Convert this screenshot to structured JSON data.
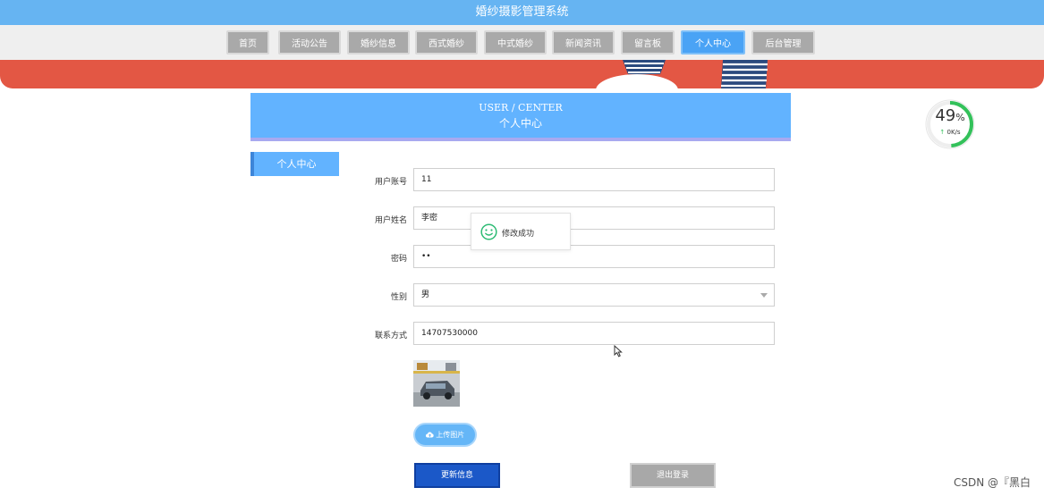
{
  "app": {
    "title": "婚纱摄影管理系统"
  },
  "nav": {
    "items": [
      {
        "label": "首页"
      },
      {
        "label": "活动公告"
      },
      {
        "label": "婚纱信息"
      },
      {
        "label": "西式婚纱"
      },
      {
        "label": "中式婚纱"
      },
      {
        "label": "新闻资讯"
      },
      {
        "label": "留言板"
      },
      {
        "label": "个人中心"
      },
      {
        "label": "后台管理"
      }
    ],
    "active_index": 7
  },
  "header": {
    "title_en": "USER / CENTER",
    "title_cn": "个人中心"
  },
  "side_menu": {
    "item": "个人中心"
  },
  "form": {
    "account": {
      "label": "用户账号",
      "value": "11"
    },
    "name": {
      "label": "用户姓名",
      "value": "李密"
    },
    "password": {
      "label": "密码",
      "value": "••"
    },
    "gender": {
      "label": "性别",
      "value": "男"
    },
    "contact": {
      "label": "联系方式",
      "value": "14707530000"
    }
  },
  "toast": {
    "text": "修改成功",
    "icon": "smile-icon"
  },
  "buttons": {
    "upload": "上传图片",
    "update": "更新信息",
    "logout": "退出登录"
  },
  "speed_widget": {
    "percent": "49",
    "unit": "%",
    "rate": "0K/s",
    "progress": 0.49
  },
  "watermark": "CSDN @『黑白",
  "colors": {
    "primary": "#62b3ff",
    "update_button": "#1b58c8",
    "banner": "#e35744",
    "speed_ring": "#33c15a"
  }
}
